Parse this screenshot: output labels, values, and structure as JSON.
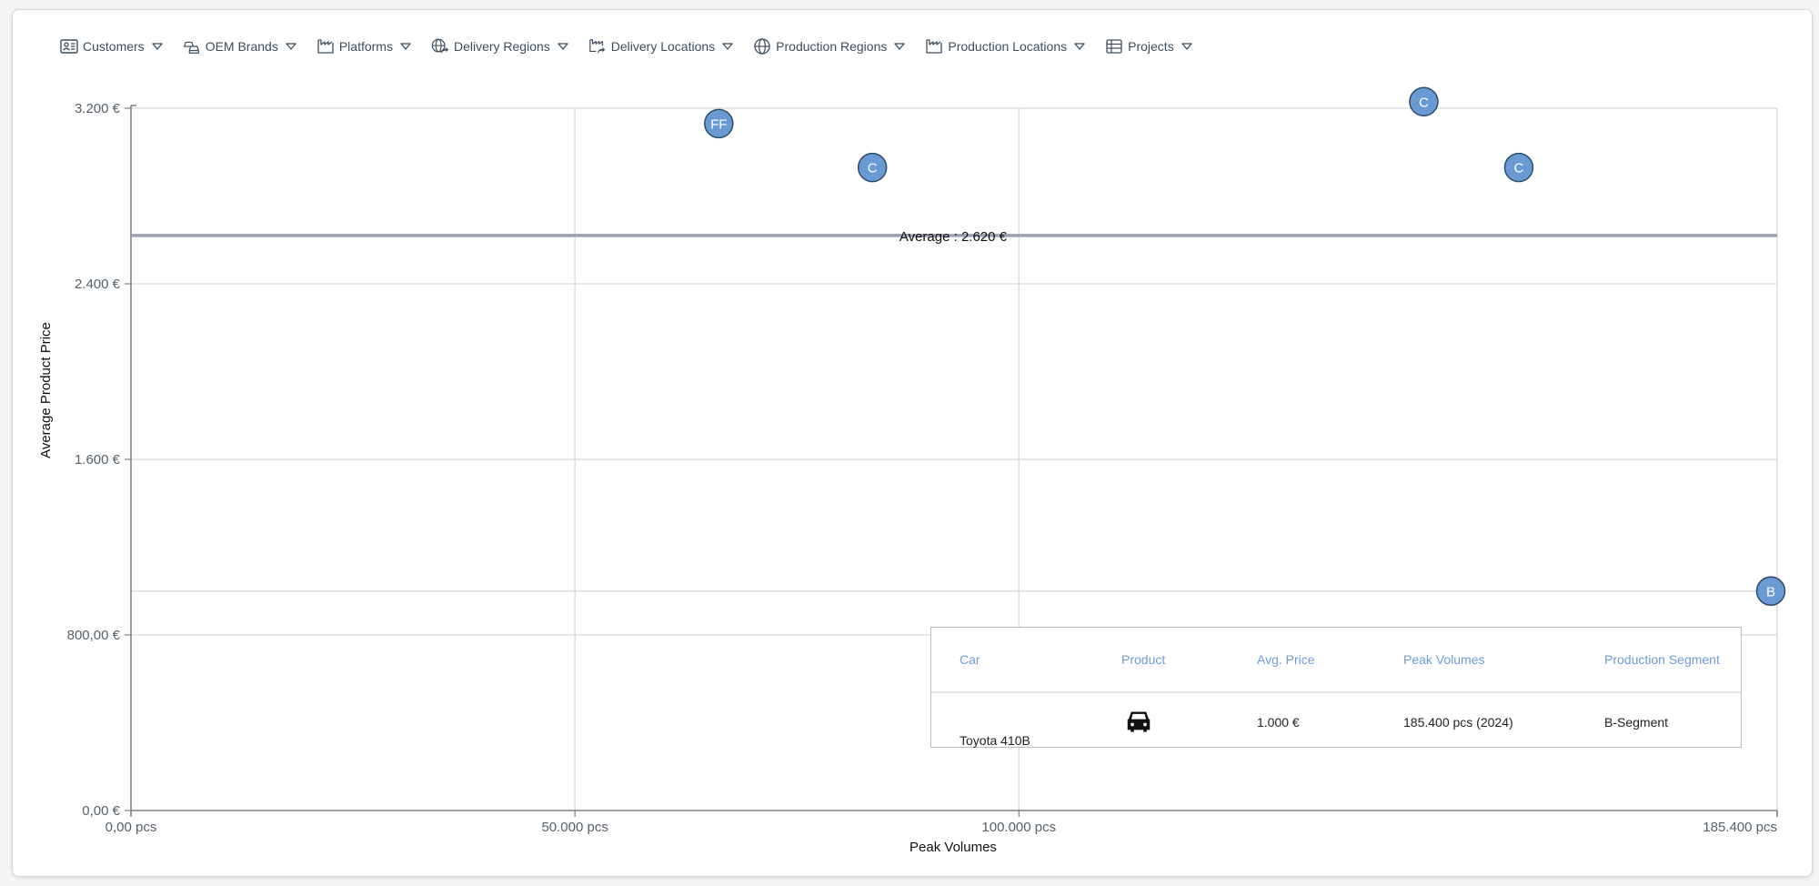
{
  "filters": [
    {
      "label": "Customers",
      "icon": "contact-card-icon"
    },
    {
      "label": "OEM Brands",
      "icon": "cars-icon"
    },
    {
      "label": "Platforms",
      "icon": "factory-icon"
    },
    {
      "label": "Delivery Regions",
      "icon": "globe-delivery-icon"
    },
    {
      "label": "Delivery Locations",
      "icon": "factory-delivery-icon"
    },
    {
      "label": "Production Regions",
      "icon": "globe-icon"
    },
    {
      "label": "Production Locations",
      "icon": "factory-icon"
    },
    {
      "label": "Projects",
      "icon": "table-icon"
    }
  ],
  "colors": {
    "bubble_fill": "#6a9ad3",
    "bubble_stroke": "#2f4a6a",
    "average_line": "#9a9fb4",
    "grid": "#dcdde0",
    "axis": "#7a7d82",
    "tooltip_header": "#6b9bd6"
  },
  "chart_data": {
    "type": "scatter",
    "title": "",
    "xlabel": "Peak Volumes",
    "ylabel": "Average Product Price",
    "xlim": [
      0,
      185400
    ],
    "ylim": [
      0,
      3200
    ],
    "x_ticks": [
      {
        "value": 0,
        "label": "0,00 pcs"
      },
      {
        "value": 50000,
        "label": "50.000 pcs"
      },
      {
        "value": 100000,
        "label": "100.000 pcs"
      },
      {
        "value": 185400,
        "label": "185.400 pcs"
      }
    ],
    "y_ticks": [
      {
        "value": 0,
        "label": "0,00 €"
      },
      {
        "value": 800,
        "label": "800,00 €"
      },
      {
        "value": 1600,
        "label": "1.600 €"
      },
      {
        "value": 2400,
        "label": "2.400 €"
      },
      {
        "value": 3200,
        "label": "3.200 €"
      }
    ],
    "grid": true,
    "average": {
      "value": 2620,
      "label": "Average : 2.620 €"
    },
    "hover_crosshair": {
      "y": 1000
    },
    "points": [
      {
        "label": "FF",
        "x": 66200,
        "y": 3130
      },
      {
        "label": "C",
        "x": 83500,
        "y": 2930
      },
      {
        "label": "C",
        "x": 145600,
        "y": 3230
      },
      {
        "label": "C",
        "x": 156300,
        "y": 2930
      },
      {
        "label": "B",
        "x": 185400,
        "y": 1000
      }
    ]
  },
  "tooltip": {
    "headers": [
      "Car",
      "Product",
      "Avg. Price",
      "Peak Volumes",
      "Production Segment"
    ],
    "row": {
      "car": "Toyota 410B",
      "product_icon": "car-icon",
      "avg_price": "1.000 €",
      "peak_volumes": "185.400 pcs (2024)",
      "production_segment": "B-Segment"
    }
  }
}
